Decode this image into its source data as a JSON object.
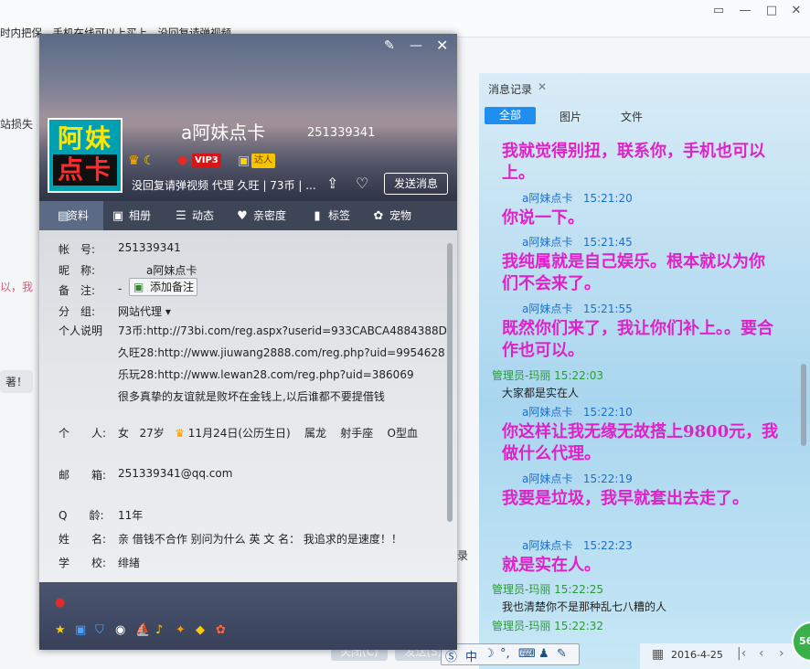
{
  "background_chat": {
    "top_line": "时内把保，手机在线可以上买上，没回复请弹视频",
    "snippet_1": "站损失",
    "snippet_2": "以，我",
    "snippet_3": "著！",
    "send_hint_1": "关闭(C)",
    "send_hint_2": "发送(S)",
    "snippet_4": "录"
  },
  "profile": {
    "avatar_line1": "阿妹",
    "avatar_line2": "点卡",
    "nickname": "a阿妹点卡",
    "qq_number": "251339341",
    "badges": {
      "vip": "VIP3",
      "talent": "达人"
    },
    "signature": "没回复请弹视频 代理 久旺 | 73币 | ...",
    "send_message_label": "发送消息",
    "tabs": [
      {
        "label": "资料",
        "icon": "profile-card-icon"
      },
      {
        "label": "相册",
        "icon": "photo-album-icon"
      },
      {
        "label": "动态",
        "icon": "feed-list-icon"
      },
      {
        "label": "亲密度",
        "icon": "heart-icon"
      },
      {
        "label": "标签",
        "icon": "bookmark-icon"
      },
      {
        "label": "宠物",
        "icon": "pet-icon"
      }
    ],
    "fields": {
      "account_label": "帐　号:",
      "account_value": "251339341",
      "nick_label": "昵　称:",
      "nick_value": "a阿妹点卡",
      "remark_label": "备　注:",
      "remark_value": "-",
      "add_remark_button": "添加备注",
      "group_label": "分　组:",
      "group_value": "网站代理",
      "desc_label": "个人说明",
      "desc_line1": "73币:http://73bi.com/reg.aspx?userid=933CABCA4884388D",
      "desc_line2": "久旺28:http://www.jiuwang2888.com/reg.php?uid=9954628",
      "desc_line3": "乐玩28:http://www.lewan28.com/reg.php?uid=386069",
      "desc_line4": "很多真挚的友谊就是败坏在金钱上,以后谁都不要提借钱",
      "personal_label": "个　　人:",
      "gender": "女",
      "age": "27岁",
      "birthday": "11月24日(公历生日)",
      "zodiac_cn": "属龙",
      "constellation": "射手座",
      "blood": "O型血",
      "email_label": "邮　　箱:",
      "email_value": "251339341@qq.com",
      "qage_label": "Q　　龄:",
      "qage_value": "11年",
      "name_label": "姓　　名:",
      "name_value": "亲 借钱不合作 别问为什么 英 文 名： 我追求的是速度！！",
      "school_label": "学　　校:",
      "school_value": "绯緖"
    }
  },
  "message_panel": {
    "title": "消息记录",
    "filters": {
      "all": "全部",
      "images": "图片",
      "files": "文件"
    },
    "messages": [
      {
        "type": "big",
        "text": "我就觉得别扭，联系你，手机也可以上。"
      },
      {
        "type": "head",
        "sender": "a阿妹点卡",
        "time": "15:21:20",
        "color": "blue"
      },
      {
        "type": "big",
        "text": "你说一下。"
      },
      {
        "type": "head",
        "sender": "a阿妹点卡",
        "time": "15:21:45",
        "color": "blue"
      },
      {
        "type": "big",
        "text": "我纯属就是自己娱乐。根本就以为你们不会来了。"
      },
      {
        "type": "head",
        "sender": "a阿妹点卡",
        "time": "15:21:55",
        "color": "blue"
      },
      {
        "type": "big",
        "text": "既然你们来了，我让你们补上。。要合作也可以。"
      },
      {
        "type": "head",
        "sender": "管理员-玛丽",
        "time": "15:22:03",
        "color": "green"
      },
      {
        "type": "small",
        "text": "大家都是实在人"
      },
      {
        "type": "head",
        "sender": "a阿妹点卡",
        "time": "15:22:10",
        "color": "blue"
      },
      {
        "type": "big",
        "text": "你这样让我无缘无故搭上9800元，我做什么代理。"
      },
      {
        "type": "head",
        "sender": "a阿妹点卡",
        "time": "15:22:19",
        "color": "blue"
      },
      {
        "type": "big",
        "text": "我要是垃圾，我早就套出去走了。"
      },
      {
        "type": "head",
        "sender": "a阿妹点卡",
        "time": "15:22:23",
        "color": "blue"
      },
      {
        "type": "big",
        "text": "就是实在人。"
      },
      {
        "type": "head",
        "sender": "管理员-玛丽",
        "time": "15:22:25",
        "color": "green"
      },
      {
        "type": "small",
        "text": "我也清楚你不是那种乱七八糟的人"
      },
      {
        "type": "head",
        "sender": "管理员-玛丽",
        "time": "15:22:32",
        "color": "green"
      }
    ],
    "date": "2016-4-25",
    "badge_text": "56"
  },
  "ime": {
    "mode": "中"
  },
  "colors": {
    "accent": "#1e8ff0",
    "big_message": "#e020c8",
    "sender_blue": "#1e6fc9",
    "sender_green": "#2a9a3a"
  }
}
